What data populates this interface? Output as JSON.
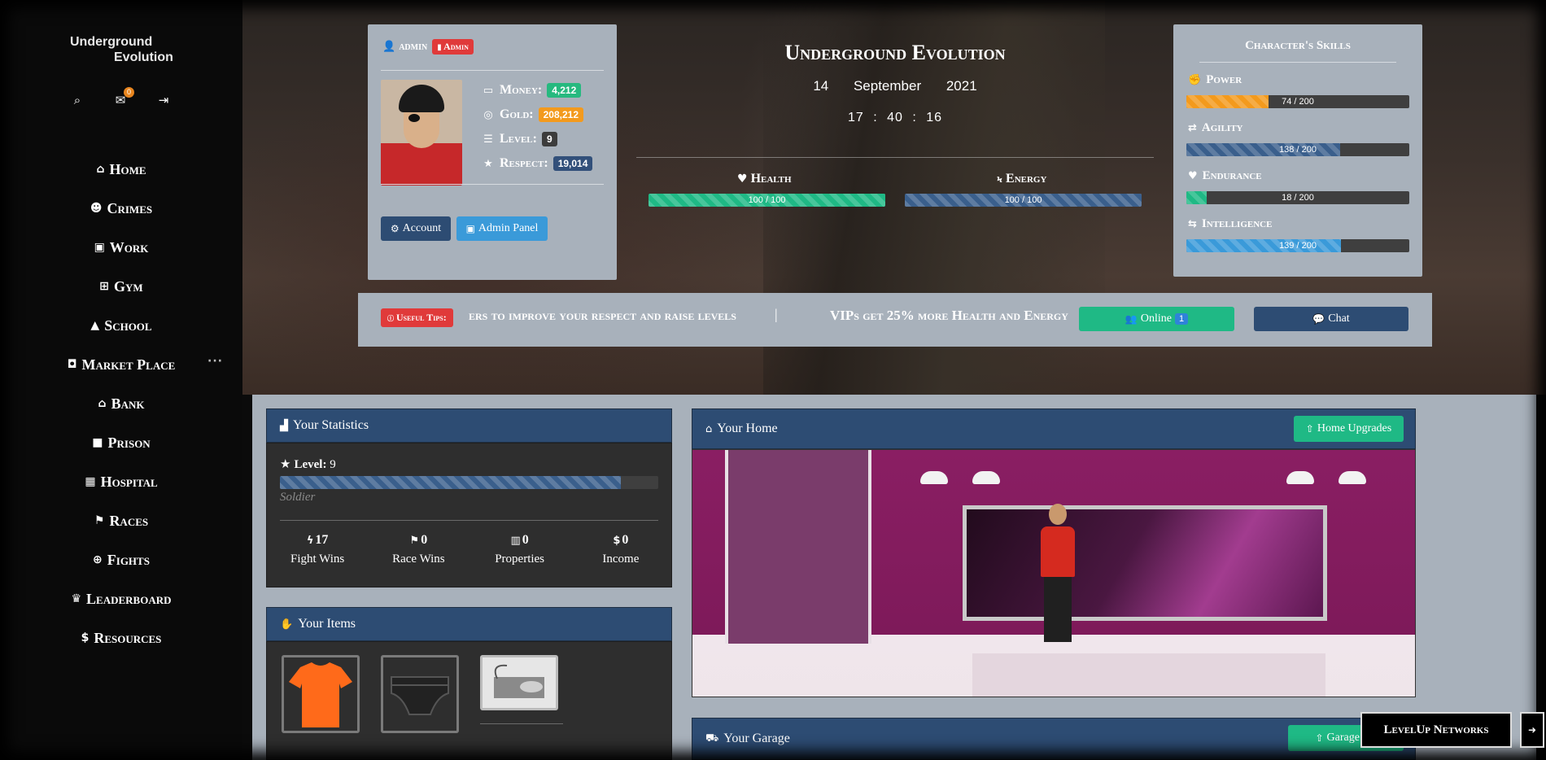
{
  "logo": {
    "line1": "Underground",
    "line2": "Evolution"
  },
  "top_icons": {
    "mail_count": "0"
  },
  "nav": [
    {
      "label": "Home",
      "icon": "home-icon",
      "glyph": "⌂"
    },
    {
      "label": "Crimes",
      "icon": "mask-icon",
      "glyph": "☻"
    },
    {
      "label": "Work",
      "icon": "briefcase-icon",
      "glyph": "▣"
    },
    {
      "label": "Gym",
      "icon": "dumbbell-icon",
      "glyph": "⊞"
    },
    {
      "label": "School",
      "icon": "graduation-icon",
      "glyph": "▲"
    },
    {
      "label": "Market Place",
      "icon": "shopping-bag-icon",
      "glyph": "◘"
    },
    {
      "label": "Bank",
      "icon": "bank-icon",
      "glyph": "⌂"
    },
    {
      "label": "Prison",
      "icon": "lock-icon",
      "glyph": "■"
    },
    {
      "label": "Hospital",
      "icon": "hospital-icon",
      "glyph": "▦"
    },
    {
      "label": "Races",
      "icon": "checkered-flag-icon",
      "glyph": "⚑"
    },
    {
      "label": "Fights",
      "icon": "crosshairs-icon",
      "glyph": "⊕"
    },
    {
      "label": "Leaderboard",
      "icon": "trophy-icon",
      "glyph": "♛"
    },
    {
      "label": "Resources",
      "icon": "dollar-icon",
      "glyph": "$"
    }
  ],
  "profile": {
    "username": "admin",
    "role_tag": "Admin",
    "money_label": "Money:",
    "money_value": "4,212",
    "gold_label": "Gold:",
    "gold_value": "208,212",
    "level_label": "Level:",
    "level_value": "9",
    "respect_label": "Respect:",
    "respect_value": "19,014",
    "account_btn": "Account",
    "admin_btn": "Admin Panel"
  },
  "header": {
    "title": "Underground Evolution",
    "date": "14 September 2021",
    "time": "17 : 40 : 16"
  },
  "vitals": {
    "health_label": "Health",
    "health_text": "100 / 100",
    "health_pct": 100,
    "energy_label": "Energy",
    "energy_text": "100 / 100",
    "energy_pct": 100
  },
  "skills": {
    "title": "Character's Skills",
    "items": [
      {
        "label": "Power",
        "text": "74 / 200",
        "pct": 37,
        "color": "#f39a1d"
      },
      {
        "label": "Agility",
        "text": "138 / 200",
        "pct": 69,
        "color": "#3a5f8c"
      },
      {
        "label": "Endurance",
        "text": "18 / 200",
        "pct": 9,
        "color": "#1fb985"
      },
      {
        "label": "Intelligence",
        "text": "139 / 200",
        "pct": 69.5,
        "color": "#3a9ad9"
      }
    ]
  },
  "tips": {
    "tag": "Useful Tips:",
    "text1": "ers to improve your respect and raise levels",
    "separator": "|",
    "text2": "VIPs get 25% more Health and Energy",
    "online_label": "Online",
    "online_count": "1",
    "chat_label": "Chat"
  },
  "statistics": {
    "title": "Your Statistics",
    "level_label": "Level:",
    "level_value": "9",
    "level_pct": 90,
    "rank": "Soldier",
    "cols": [
      {
        "value": "17",
        "label": "Fight Wins",
        "glyph": "ϟ"
      },
      {
        "value": "0",
        "label": "Race Wins",
        "glyph": "⚑"
      },
      {
        "value": "0",
        "label": "Properties",
        "glyph": "▥"
      },
      {
        "value": "0",
        "label": "Income",
        "glyph": "$"
      }
    ]
  },
  "items": {
    "title": "Your Items"
  },
  "home": {
    "title": "Your Home",
    "upgrade_btn": "Home Upgrades"
  },
  "garage": {
    "title": "Your Garage",
    "upgrade_btn": "Garage Up"
  },
  "footer": {
    "levelup": "LevelUp Networks"
  },
  "colors": {
    "navy": "#2d4c73",
    "panel": "#a8b1bb",
    "green": "#1fb985",
    "red": "#e03a3a"
  }
}
